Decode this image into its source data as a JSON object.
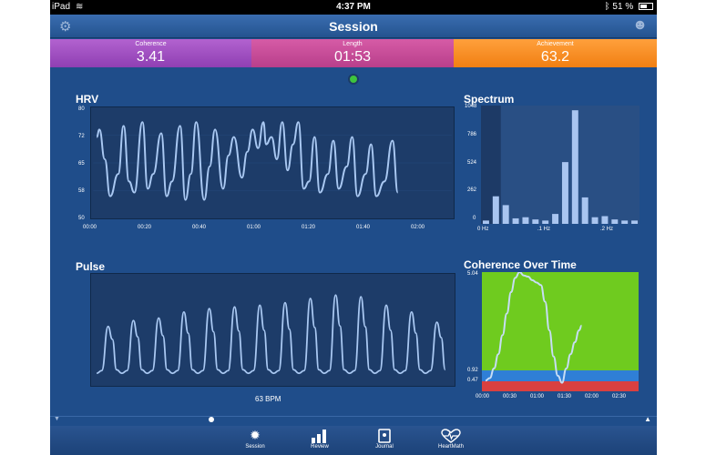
{
  "status_bar": {
    "device": "iPad",
    "time": "4:37 PM",
    "battery": "51 %"
  },
  "nav": {
    "title": "Session",
    "left_icon": "gear-icon",
    "right_icon": "smiley-icon"
  },
  "stats": [
    {
      "label": "Coherence",
      "value": "3.41"
    },
    {
      "label": "Length",
      "value": "01:53"
    },
    {
      "label": "Achievement",
      "value": "63.2"
    }
  ],
  "hrv": {
    "title": "HRV",
    "y_ticks": [
      "80",
      "72",
      "65",
      "58",
      "50"
    ],
    "x_ticks": [
      "00:00",
      "00:20",
      "00:40",
      "01:00",
      "01:20",
      "01:40",
      "02:00"
    ]
  },
  "spectrum": {
    "title": "Spectrum",
    "y_ticks": [
      "1048",
      "786",
      "524",
      "262",
      "0"
    ],
    "x_ticks": [
      "0 Hz",
      ".1 Hz",
      ".2 Hz"
    ]
  },
  "pulse": {
    "title": "Pulse",
    "bpm": "63 BPM"
  },
  "coherence_over_time": {
    "title": "Coherence Over Time",
    "y_ticks": [
      "5.04",
      "0.92",
      "0.47"
    ],
    "x_ticks": [
      "00:00",
      "00:30",
      "01:00",
      "01:30",
      "02:00",
      "02:30"
    ]
  },
  "tabs": [
    {
      "label": "Session",
      "icon": "sun-icon"
    },
    {
      "label": "Review",
      "icon": "bar-chart-icon"
    },
    {
      "label": "Journal",
      "icon": "notebook-icon"
    },
    {
      "label": "HeartMath",
      "icon": "heart-wave-icon"
    }
  ],
  "chart_data": [
    {
      "type": "line",
      "title": "HRV",
      "ylim": [
        50,
        80
      ],
      "xlim": [
        0,
        120
      ],
      "x_ticks": [
        "00:00",
        "00:20",
        "00:40",
        "01:00",
        "01:20",
        "01:40",
        "02:00"
      ],
      "x": [
        0,
        1,
        3,
        5,
        8,
        10,
        12,
        14,
        17,
        19,
        21,
        24,
        26,
        28,
        31,
        33,
        35,
        37,
        40,
        42,
        44,
        47,
        49,
        51,
        54,
        56,
        58,
        60,
        62,
        63,
        65,
        67,
        69,
        71,
        73,
        75,
        77,
        79,
        81,
        83,
        86,
        88,
        90,
        93,
        95,
        97,
        100,
        102,
        104,
        107,
        110,
        112
      ],
      "y": [
        72,
        74,
        66,
        56,
        62,
        75,
        60,
        57,
        76,
        58,
        62,
        73,
        56,
        60,
        75,
        55,
        62,
        76,
        55,
        64,
        74,
        58,
        67,
        72,
        61,
        68,
        74,
        69,
        76,
        70,
        72,
        66,
        76,
        63,
        70,
        76,
        58,
        60,
        72,
        57,
        62,
        71,
        58,
        64,
        72,
        56,
        62,
        70,
        56,
        60,
        71,
        57
      ]
    },
    {
      "type": "bar",
      "title": "Spectrum",
      "ylim": [
        0,
        1048
      ],
      "x_ticks": [
        "0 Hz",
        ".1 Hz",
        ".2 Hz"
      ],
      "values": [
        30,
        250,
        170,
        50,
        60,
        40,
        30,
        90,
        560,
        1030,
        240,
        60,
        70,
        40,
        30,
        30
      ],
      "highlight_count": 2
    },
    {
      "type": "line",
      "title": "Pulse",
      "ylim": [
        0,
        1
      ],
      "xlim": [
        0,
        100
      ],
      "peaks": [
        0.55,
        0.62,
        0.65,
        0.72,
        0.76,
        0.78,
        0.8,
        0.83,
        0.88,
        0.92,
        0.9,
        0.8,
        0.72,
        0.6
      ],
      "beats": 14
    },
    {
      "type": "area",
      "title": "Coherence Over Time",
      "ylim": [
        0,
        5.04
      ],
      "x_ticks": [
        "00:00",
        "00:30",
        "01:00",
        "01:30",
        "02:00",
        "02:30"
      ],
      "x": [
        0,
        5,
        10,
        15,
        20,
        25,
        30,
        35,
        40,
        45,
        50,
        55,
        60,
        65,
        70,
        75,
        80,
        85,
        90,
        95,
        100,
        105,
        110,
        113
      ],
      "y": [
        0.5,
        0.6,
        1.0,
        1.6,
        2.4,
        3.3,
        4.2,
        4.8,
        5.04,
        4.9,
        4.85,
        4.7,
        4.6,
        4.5,
        3.8,
        2.6,
        1.5,
        0.7,
        0.4,
        1.0,
        1.6,
        2.1,
        2.6,
        2.8
      ],
      "bands": [
        {
          "from": 0.92,
          "to": 5.04,
          "color": "#6fcb1f"
        },
        {
          "from": 0.47,
          "to": 0.92,
          "color": "#2f7fd6"
        },
        {
          "from": 0,
          "to": 0.47,
          "color": "#d94040"
        }
      ]
    }
  ]
}
